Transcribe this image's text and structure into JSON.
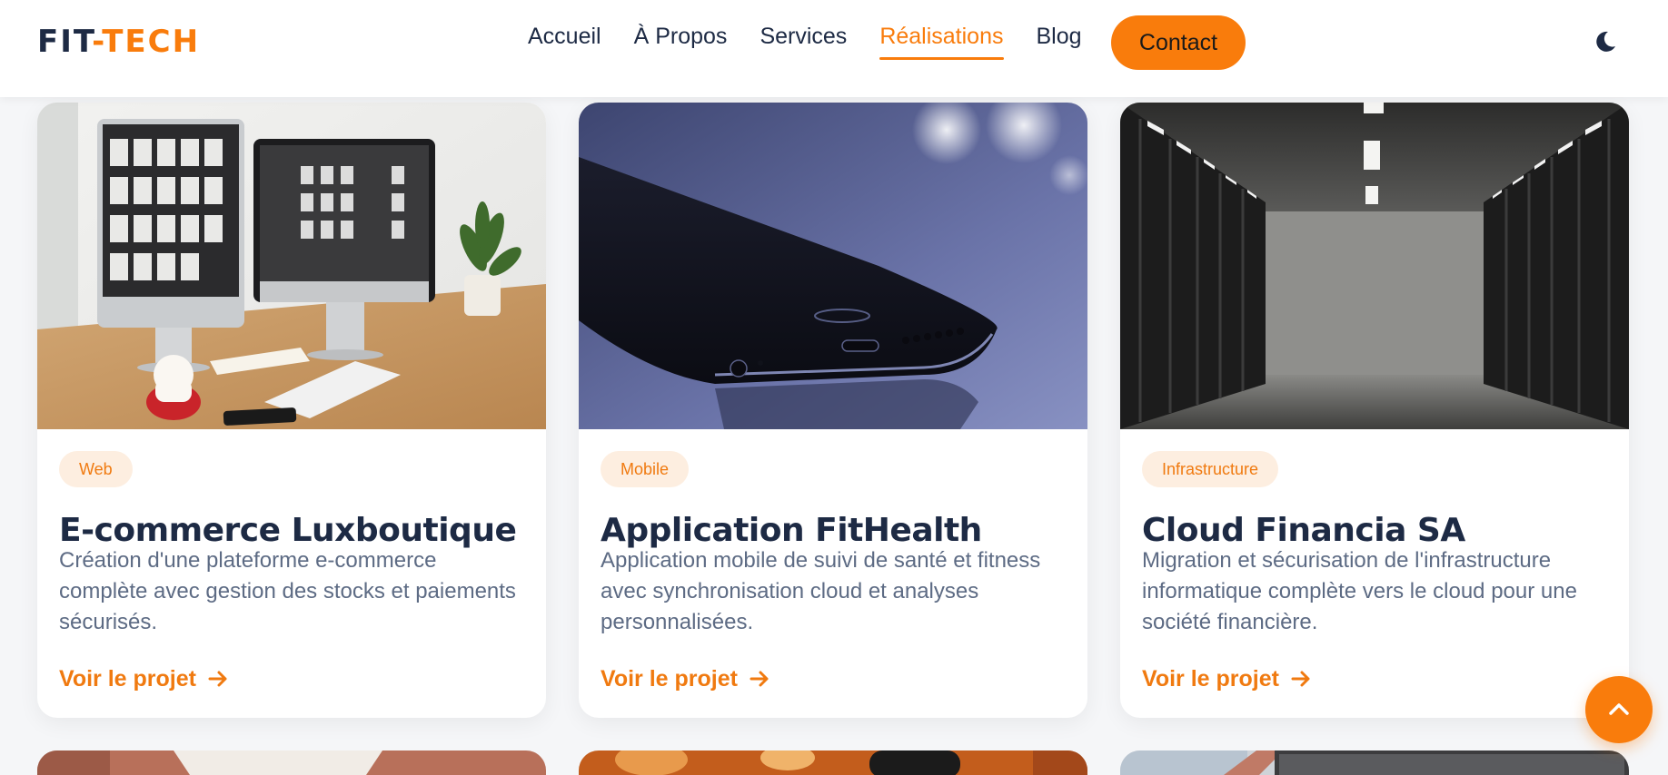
{
  "logo": {
    "part1": "FIT",
    "dash": "-",
    "part2": "TECH"
  },
  "nav": {
    "items": [
      {
        "label": "Accueil"
      },
      {
        "label": "À Propos"
      },
      {
        "label": "Services"
      },
      {
        "label": "Réalisations",
        "active": true
      },
      {
        "label": "Blog"
      }
    ],
    "contact_label": "Contact"
  },
  "theme_icon": "moon-icon",
  "cards": [
    {
      "badge": "Web",
      "title": "E-commerce Luxboutique",
      "description": "Création d'une plateforme e-commerce complète avec gestion des stocks et paiements sécurisés.",
      "link": "Voir le projet"
    },
    {
      "badge": "Mobile",
      "title": "Application FitHealth",
      "description": "Application mobile de suivi de santé et fitness avec synchronisation cloud et analyses personnalisées.",
      "link": "Voir le projet"
    },
    {
      "badge": "Infrastructure",
      "title": "Cloud Financia SA",
      "description": "Migration et sécurisation de l'infrastructure informatique complète vers le cloud pour une société financière.",
      "link": "Voir le projet"
    }
  ],
  "colors": {
    "accent": "#f97c0c",
    "navy": "#1d2a44",
    "muted": "#5d6b84",
    "badge_bg": "#fdeee0"
  }
}
